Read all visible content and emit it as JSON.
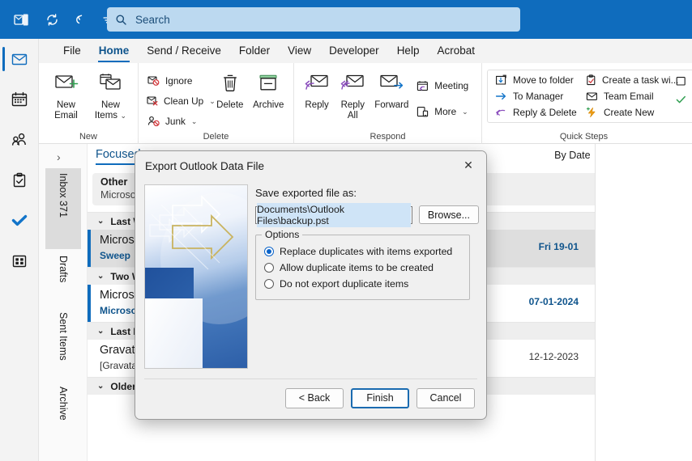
{
  "titlebar": {
    "icons": [
      "outlook-logo-icon",
      "refresh-icon",
      "undo-icon",
      "customize-toolbar-icon"
    ],
    "search": {
      "placeholder": "Search",
      "value": "Search",
      "icon": "search-icon"
    }
  },
  "navrail": {
    "items": [
      {
        "name": "mail",
        "icon": "mail-icon",
        "active": true
      },
      {
        "name": "calendar",
        "icon": "calendar-icon",
        "active": false
      },
      {
        "name": "people",
        "icon": "people-icon",
        "active": false
      },
      {
        "name": "tasks",
        "icon": "clipboard-check-icon",
        "active": false
      },
      {
        "name": "todo",
        "icon": "checkmark-icon",
        "active": false
      },
      {
        "name": "more-apps",
        "icon": "apps-grid-icon",
        "active": false
      }
    ]
  },
  "ribbon": {
    "tabs": [
      {
        "label": "File",
        "active": false
      },
      {
        "label": "Home",
        "active": true
      },
      {
        "label": "Send / Receive",
        "active": false
      },
      {
        "label": "Folder",
        "active": false
      },
      {
        "label": "View",
        "active": false
      },
      {
        "label": "Developer",
        "active": false
      },
      {
        "label": "Help",
        "active": false
      },
      {
        "label": "Acrobat",
        "active": false
      }
    ],
    "groups": [
      {
        "label": "New",
        "big": [
          {
            "label_line1": "New",
            "label_line2": "Email",
            "icon": "new-email-icon"
          },
          {
            "label_line1": "New",
            "label_line2": "Items",
            "icon": "new-items-icon",
            "dropdown": true
          }
        ]
      },
      {
        "label": "Delete",
        "small": [
          {
            "label": "Ignore",
            "icon": "ignore-icon",
            "dropdown": false
          },
          {
            "label": "Clean Up",
            "icon": "cleanup-icon",
            "dropdown": true
          },
          {
            "label": "Junk",
            "icon": "junk-icon",
            "dropdown": true
          }
        ],
        "big": [
          {
            "label_line1": "Delete",
            "label_line2": "",
            "icon": "trash-icon"
          },
          {
            "label_line1": "Archive",
            "label_line2": "",
            "icon": "archive-icon"
          }
        ]
      },
      {
        "label": "Respond",
        "big": [
          {
            "label_line1": "Reply",
            "label_line2": "",
            "icon": "reply-icon"
          },
          {
            "label_line1": "Reply",
            "label_line2": "All",
            "icon": "reply-all-icon"
          },
          {
            "label_line1": "Forward",
            "label_line2": "",
            "icon": "forward-icon"
          }
        ],
        "small": [
          {
            "label": "Meeting",
            "icon": "meeting-icon",
            "dropdown": false
          },
          {
            "label": "More",
            "icon": "more-respond-icon",
            "dropdown": true
          }
        ]
      },
      {
        "label": "Quick Steps",
        "quick_steps": [
          {
            "label": "Move to folder",
            "icon": "move-to-folder-icon"
          },
          {
            "label": "To Manager",
            "icon": "to-manager-icon"
          },
          {
            "label": "Reply & Delete",
            "icon": "reply-delete-icon"
          },
          {
            "label": "Create a task wi...",
            "icon": "create-task-icon"
          },
          {
            "label": "Team Email",
            "icon": "team-email-icon"
          },
          {
            "label": "Create New",
            "icon": "create-new-icon"
          }
        ]
      }
    ]
  },
  "folders": {
    "expand_icon": "chevron-right-icon",
    "items": [
      {
        "label": "Inbox 371",
        "selected": true
      },
      {
        "label": "Drafts",
        "selected": false
      },
      {
        "label": "Sent Items",
        "selected": false
      },
      {
        "label": "Archive",
        "selected": false
      }
    ]
  },
  "maillist": {
    "focused_tab": "Focused",
    "sort_label": "By Date",
    "sort_dropdown_icon": "chevron-down-icon",
    "sort_direction_icon": "arrow-down-icon",
    "other_row": {
      "title": "Other",
      "preview": "Microsoft Partner Center, Xbox, Zapier..."
    },
    "groups": [
      {
        "label": "Last Week",
        "collapse_icon": "chevron-down-icon"
      },
      {
        "label": "Two Weeks Ago",
        "collapse_icon": "chevron-down-icon"
      },
      {
        "label": "Last Month",
        "collapse_icon": "chevron-down-icon"
      },
      {
        "label": "Older",
        "collapse_icon": "chevron-down-icon"
      }
    ],
    "rows": [
      {
        "sender": "Microsoft",
        "subject": "Sweep",
        "date": "Fri 19-01",
        "unread": true,
        "selected": true
      },
      {
        "sender": "Microsoft",
        "subject": "Microsoft",
        "date": "07-01-2024",
        "unread": true,
        "selected": false
      },
      {
        "sender": "Gravatar",
        "subject": "[Gravatar] Verify email address",
        "date": "12-12-2023",
        "unread": false,
        "selected": false
      }
    ]
  },
  "dialog": {
    "title": "Export Outlook Data File",
    "close_icon": "close-icon",
    "art_icon": "export-arrows-artwork",
    "save_label": "Save exported file as:",
    "path_value": "Documents\\Outlook Files\\backup.pst",
    "browse_label": "Browse...",
    "options_title": "Options",
    "options": [
      {
        "label": "Replace duplicates with items exported",
        "checked": true
      },
      {
        "label": "Allow duplicate items to be created",
        "checked": false
      },
      {
        "label": "Do not export duplicate items",
        "checked": false
      }
    ],
    "buttons": [
      {
        "label": "< Back",
        "primary": false
      },
      {
        "label": "Finish",
        "primary": true
      },
      {
        "label": "Cancel",
        "primary": false
      }
    ]
  },
  "colors": {
    "titlebar_blue": "#0f6cbd",
    "accent_blue": "#0f548c",
    "selection_blue": "#cfe4f7",
    "radio_blue": "#0a63c9"
  }
}
